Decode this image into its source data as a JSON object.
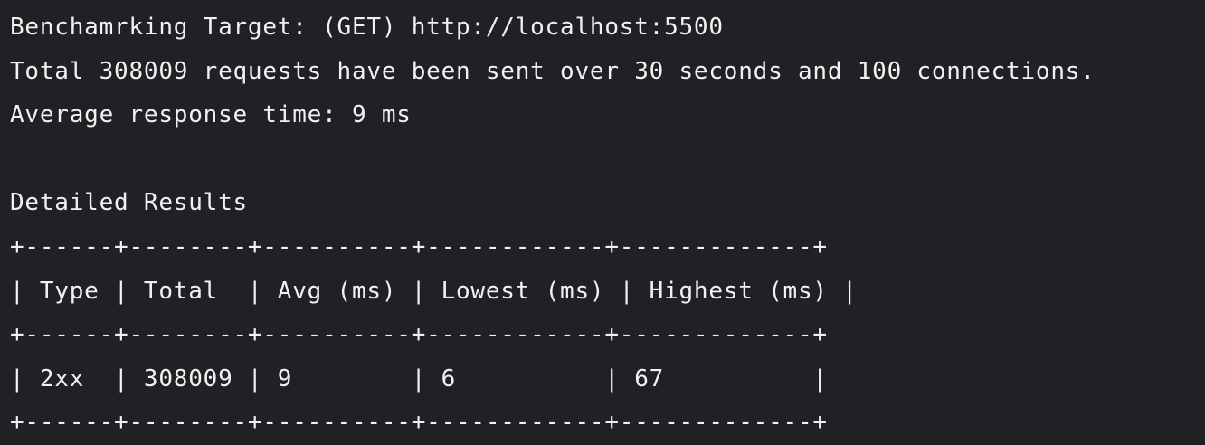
{
  "summary": {
    "target_line": "Benchamrking Target: (GET) http://localhost:5500",
    "total_line": "Total 308009 requests have been sent over 30 seconds and 100 connections.",
    "avg_line": "Average response time: 9 ms"
  },
  "section": {
    "title": "Detailed Results"
  },
  "table": {
    "border": "+------+--------+----------+------------+-------------+",
    "header_row": "| Type | Total  | Avg (ms) | Lowest (ms) | Highest (ms) |",
    "data_row": "| 2xx  | 308009 | 9        | 6          | 67          |",
    "columns": [
      "Type",
      "Total",
      "Avg (ms)",
      "Lowest (ms)",
      "Highest (ms)"
    ],
    "rows": [
      [
        "2xx",
        "308009",
        "9",
        "6",
        "67"
      ]
    ]
  }
}
